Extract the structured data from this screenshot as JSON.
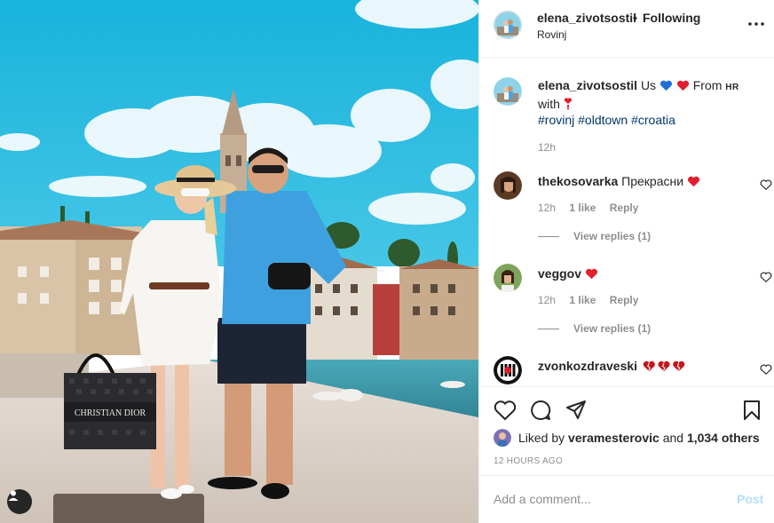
{
  "header": {
    "username": "elena_zivotsostil",
    "separator": "•",
    "follow_status": "Following",
    "location": "Rovinj",
    "more_icon": "more-horizontal-icon"
  },
  "caption": {
    "username": "elena_zivotsostil",
    "text_1": "Us",
    "text_2": "From",
    "flag_code": "HR",
    "text_3": "with",
    "hashtags": [
      "#rovinj",
      "#oldtown",
      "#croatia"
    ],
    "time": "12h"
  },
  "comments": [
    {
      "username": "thekosovarka",
      "text": "Прекрасни",
      "time": "12h",
      "likes": "1 like",
      "reply": "Reply",
      "view_replies": "View replies (1)"
    },
    {
      "username": "veggov",
      "text": "",
      "time": "12h",
      "likes": "1 like",
      "reply": "Reply",
      "view_replies": "View replies (1)"
    },
    {
      "username": "zvonkozdraveski",
      "text": ""
    }
  ],
  "photo": {
    "bag_text": "CHRISTIAN DIOR"
  },
  "likes": {
    "prefix": "Liked by",
    "user": "veramesterovic",
    "mid": "and",
    "count": "1,034 others"
  },
  "post_age": "12 HOURS AGO",
  "add_comment": {
    "placeholder": "Add a comment...",
    "post_label": "Post"
  },
  "colors": {
    "sky": "#24b7dc",
    "link": "#00376b",
    "heart_red": "#ed4956",
    "heart_blue": "#1f6fd6",
    "muted": "#8e8e8e",
    "post_disabled": "#b2dffc"
  }
}
